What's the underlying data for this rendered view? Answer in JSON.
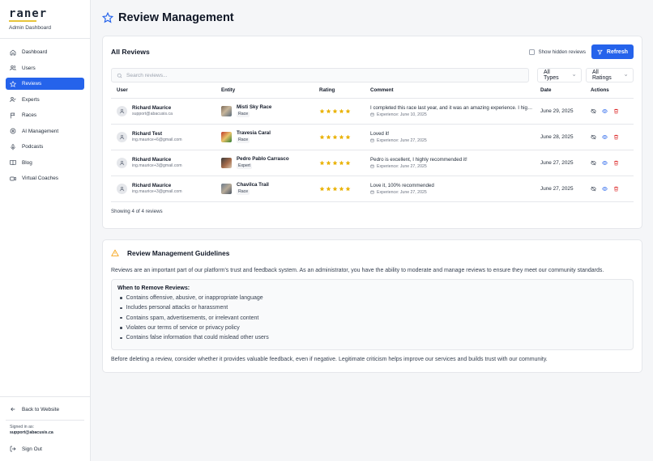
{
  "sidebar": {
    "logo": "raner",
    "subtitle": "Admin Dashboard",
    "items": [
      {
        "label": "Dashboard",
        "icon": "home-icon"
      },
      {
        "label": "Users",
        "icon": "users-icon"
      },
      {
        "label": "Reviews",
        "icon": "star-icon",
        "active": true
      },
      {
        "label": "Experts",
        "icon": "user-check-icon"
      },
      {
        "label": "Races",
        "icon": "flag-icon"
      },
      {
        "label": "AI Management",
        "icon": "brain-icon"
      },
      {
        "label": "Podcasts",
        "icon": "microphone-icon"
      },
      {
        "label": "Blog",
        "icon": "book-icon"
      },
      {
        "label": "Virtual Coaches",
        "icon": "video-icon"
      }
    ],
    "back_label": "Back to Website",
    "signed_in_label": "Signed in as:",
    "signed_in_email": "support@abacusis.ca",
    "sign_out_label": "Sign Out"
  },
  "page": {
    "title": "Review Management"
  },
  "reviews": {
    "title": "All Reviews",
    "show_hidden_label": "Show hidden reviews",
    "refresh_label": "Refresh",
    "search_placeholder": "Search reviews...",
    "type_filter": "All Types",
    "rating_filter": "All Ratings",
    "columns": [
      "User",
      "Entity",
      "Rating",
      "Comment",
      "Date",
      "Actions"
    ],
    "rows": [
      {
        "name": "Richard Maurice",
        "email": "support@abacusis.ca",
        "entity": "Misti Sky Race",
        "entity_type": "Race",
        "rating": 5,
        "comment": "I completed this race last year, and it was an amazing experience. I highly recommend it!",
        "experience": "Experience: June 10, 2025",
        "date": "June 29, 2025"
      },
      {
        "name": "Richard Test",
        "email": "ing.maurice+6@gmail.com",
        "entity": "Travesia Caral",
        "entity_type": "Race",
        "rating": 5,
        "comment": "Loved it!",
        "experience": "Experience: June 27, 2025",
        "date": "June 28, 2025"
      },
      {
        "name": "Richard Maurice",
        "email": "ing.maurice+3@gmail.com",
        "entity": "Pedro Pablo Carrasco",
        "entity_type": "Expert",
        "rating": 5,
        "comment": "Pedro is excellent, I highly recommended it!",
        "experience": "Experience: June 27, 2025",
        "date": "June 27, 2025"
      },
      {
        "name": "Richard Maurice",
        "email": "ing.maurice+3@gmail.com",
        "entity": "Chavilca Trail",
        "entity_type": "Race",
        "rating": 5,
        "comment": "Love it, 100% recommended",
        "experience": "Experience: June 27, 2025",
        "date": "June 27, 2025"
      }
    ],
    "showing": "Showing 4 of 4 reviews"
  },
  "guidelines": {
    "title": "Review Management Guidelines",
    "intro": "Reviews are an important part of our platform's trust and feedback system. As an administrator, you have the ability to moderate and manage reviews to ensure they meet our community standards.",
    "box_title": "When to Remove Reviews:",
    "items": [
      "Contains offensive, abusive, or inappropriate language",
      "Includes personal attacks or harassment",
      "Contains spam, advertisements, or irrelevant content",
      "Violates our terms of service or privacy policy",
      "Contains false information that could mislead other users"
    ],
    "outro": "Before deleting a review, consider whether it provides valuable feedback, even if negative. Legitimate criticism helps improve our services and builds trust with our community."
  },
  "colors": {
    "accent": "#2563eb",
    "star": "#eab308",
    "delete": "#dc2626",
    "warning": "#f59e0b",
    "logo_underline": "#e7c43a"
  }
}
